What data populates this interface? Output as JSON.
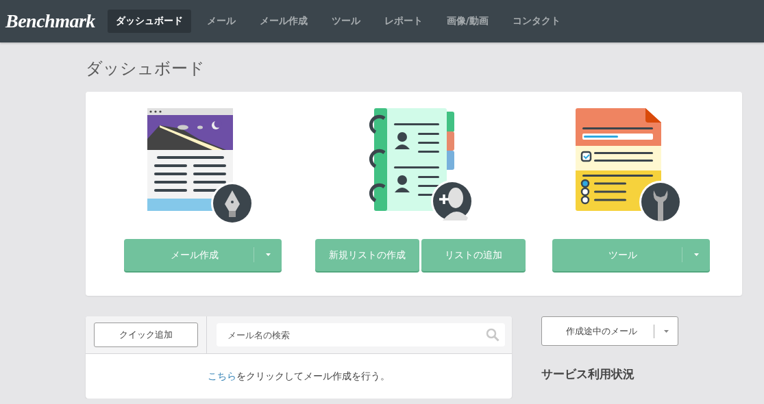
{
  "nav": {
    "logo": "Benchmark",
    "items": [
      {
        "label": "ダッシュボード",
        "selected": true
      },
      {
        "label": "メール",
        "selected": false
      },
      {
        "label": "メール作成",
        "selected": false
      },
      {
        "label": "ツール",
        "selected": false
      },
      {
        "label": "レポート",
        "selected": false
      },
      {
        "label": "画像/動画",
        "selected": false
      },
      {
        "label": "コンタクト",
        "selected": false
      }
    ]
  },
  "page_title": "ダッシュボード",
  "actions": [
    {
      "kind": "email",
      "buttons": [
        {
          "label": "メール作成",
          "dropdown": true
        }
      ]
    },
    {
      "kind": "contacts",
      "buttons": [
        {
          "label": "新規リストの作成",
          "dropdown": false
        },
        {
          "label": "リストの追加",
          "dropdown": false
        }
      ]
    },
    {
      "kind": "tools",
      "buttons": [
        {
          "label": "ツール",
          "dropdown": true
        }
      ]
    }
  ],
  "mail_panel": {
    "quick_add": "クイック追加",
    "search": {
      "placeholder": "メール名の検索"
    },
    "message": {
      "link": "こちら",
      "text": "をクリックしてメール作成を行う。"
    }
  },
  "drafts_button": {
    "label": "作成途中のメール",
    "dropdown": true
  },
  "service_heading": "サービス利用状況"
}
